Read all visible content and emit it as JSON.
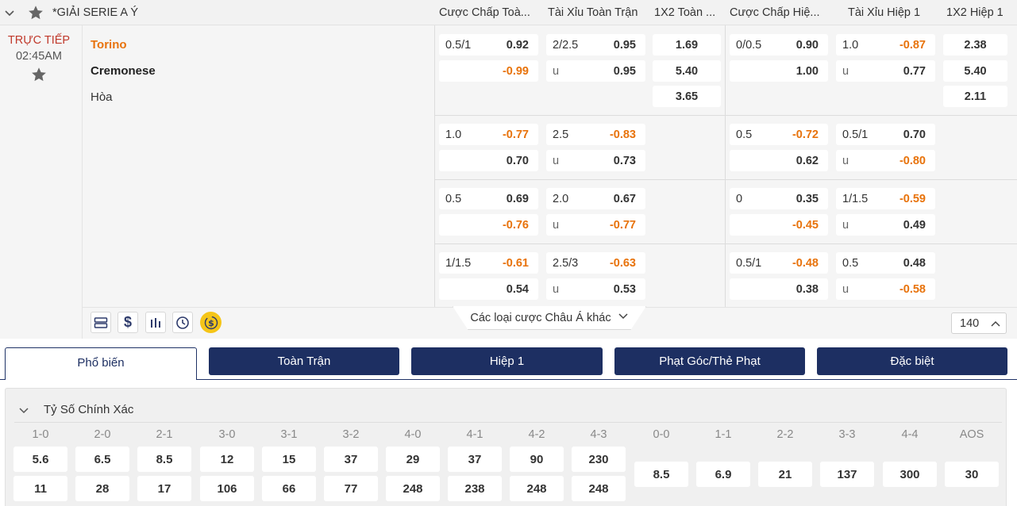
{
  "league": {
    "name": "*GIẢI SERIE A Ý",
    "collapse_icon": "chevron-down-icon",
    "fav_icon": "star-icon"
  },
  "columns": [
    "Cược Chấp Toà...",
    "Tài Xỉu Toàn Trận",
    "1X2 Toàn ...",
    "Cược Chấp Hiệ...",
    "Tài Xỉu Hiệp 1",
    "1X2 Hiệp 1"
  ],
  "match": {
    "status": "TRỰC TIẾP",
    "time": "02:45AM",
    "home": "Torino",
    "away": "Cremonese",
    "draw": "Hòa"
  },
  "lines": [
    {
      "ft_hdp": {
        "line": "0.5/1",
        "home": "0.92",
        "away": "-0.99"
      },
      "ft_ou": {
        "line": "2/2.5",
        "over": "0.95",
        "u": "u",
        "under": "0.95"
      },
      "ft_1x2": [
        "1.69",
        "5.40",
        "3.65"
      ],
      "h1_hdp": {
        "line": "0/0.5",
        "home": "0.90",
        "away": "1.00"
      },
      "h1_ou": {
        "line": "1.0",
        "over": "-0.87",
        "u": "u",
        "under": "0.77"
      },
      "h1_1x2": [
        "2.38",
        "5.40",
        "2.11"
      ]
    },
    {
      "ft_hdp": {
        "line": "1.0",
        "home": "-0.77",
        "away": "0.70"
      },
      "ft_ou": {
        "line": "2.5",
        "over": "-0.83",
        "u": "u",
        "under": "0.73"
      },
      "h1_hdp": {
        "line": "0.5",
        "home": "-0.72",
        "away": "0.62"
      },
      "h1_ou": {
        "line": "0.5/1",
        "over": "0.70",
        "u": "u",
        "under": "-0.80"
      }
    },
    {
      "ft_hdp": {
        "line": "0.5",
        "home": "0.69",
        "away": "-0.76"
      },
      "ft_ou": {
        "line": "2.0",
        "over": "0.67",
        "u": "u",
        "under": "-0.77"
      },
      "h1_hdp": {
        "line": "0",
        "home": "0.35",
        "away": "-0.45"
      },
      "h1_ou": {
        "line": "1/1.5",
        "over": "-0.59",
        "u": "u",
        "under": "0.49"
      }
    },
    {
      "ft_hdp": {
        "line": "1/1.5",
        "home": "-0.61",
        "away": "0.54"
      },
      "ft_ou": {
        "line": "2.5/3",
        "over": "-0.63",
        "u": "u",
        "under": "0.53"
      },
      "h1_hdp": {
        "line": "0.5/1",
        "home": "-0.48",
        "away": "0.38"
      },
      "h1_ou": {
        "line": "0.5",
        "over": "0.48",
        "u": "u",
        "under": "-0.58"
      }
    }
  ],
  "tools": [
    "list-icon",
    "dollar-icon",
    "bar-chart-icon",
    "history-icon",
    "cashout-icon"
  ],
  "more_asian": "Các loại cược Châu Á khác",
  "more_count": "140",
  "tabs": [
    "Phổ biến",
    "Toàn Trận",
    "Hiệp 1",
    "Phạt Góc/Thẻ Phạt",
    "Đặc biệt"
  ],
  "active_tab": 0,
  "correct_score": {
    "title": "Tỷ Số Chính Xác",
    "pairs": [
      {
        "home_label": "1-0",
        "home": "5.6",
        "away": "11"
      },
      {
        "home_label": "2-0",
        "home": "6.5",
        "away": "28"
      },
      {
        "home_label": "2-1",
        "home": "8.5",
        "away": "17"
      },
      {
        "home_label": "3-0",
        "home": "12",
        "away": "106"
      },
      {
        "home_label": "3-1",
        "home": "15",
        "away": "66"
      },
      {
        "home_label": "3-2",
        "home": "37",
        "away": "77"
      },
      {
        "home_label": "4-0",
        "home": "29",
        "away": "248"
      },
      {
        "home_label": "4-1",
        "home": "37",
        "away": "238"
      },
      {
        "home_label": "4-2",
        "home": "90",
        "away": "248"
      },
      {
        "home_label": "4-3",
        "home": "230",
        "away": "248"
      }
    ],
    "draws": [
      {
        "label": "0-0",
        "value": "8.5"
      },
      {
        "label": "1-1",
        "value": "6.9"
      },
      {
        "label": "2-2",
        "value": "21"
      },
      {
        "label": "3-3",
        "value": "137"
      },
      {
        "label": "4-4",
        "value": "300"
      },
      {
        "label": "AOS",
        "value": "30"
      }
    ]
  },
  "colors": {
    "navy": "#1d2f62",
    "negative": "#e8730c",
    "live": "#c0392b"
  }
}
